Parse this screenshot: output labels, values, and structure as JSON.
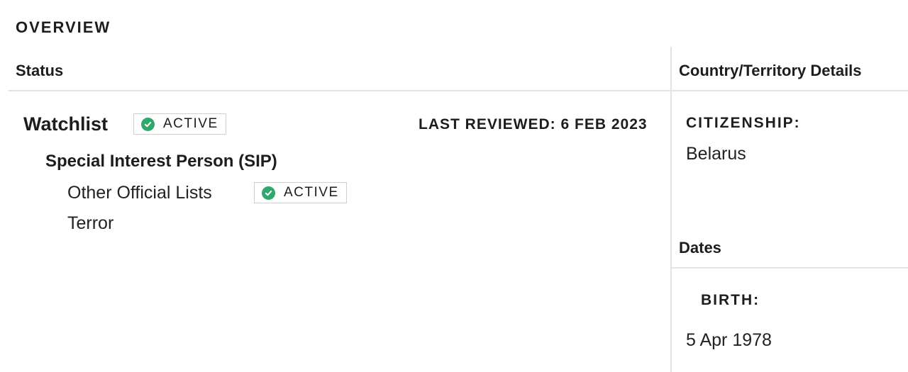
{
  "overview": {
    "title": "OVERVIEW"
  },
  "status": {
    "header": "Status",
    "watchlist": {
      "label": "Watchlist",
      "badge": {
        "label": "ACTIVE",
        "icon": "check-circle-icon",
        "color": "#2fa86b"
      },
      "last_reviewed": "LAST REVIEWED: 6 FEB 2023"
    },
    "category": "Special Interest Person (SIP)",
    "subcategories": [
      {
        "label": "Other Official Lists",
        "badge": {
          "label": "ACTIVE",
          "icon": "check-circle-icon",
          "color": "#2fa86b"
        }
      },
      {
        "label": "Terror"
      }
    ]
  },
  "country": {
    "header": "Country/Territory Details",
    "citizenship_label": "CITIZENSHIP:",
    "citizenship_value": "Belarus"
  },
  "dates": {
    "header": "Dates",
    "birth_label": "BIRTH:",
    "birth_value": "5 Apr 1978"
  }
}
